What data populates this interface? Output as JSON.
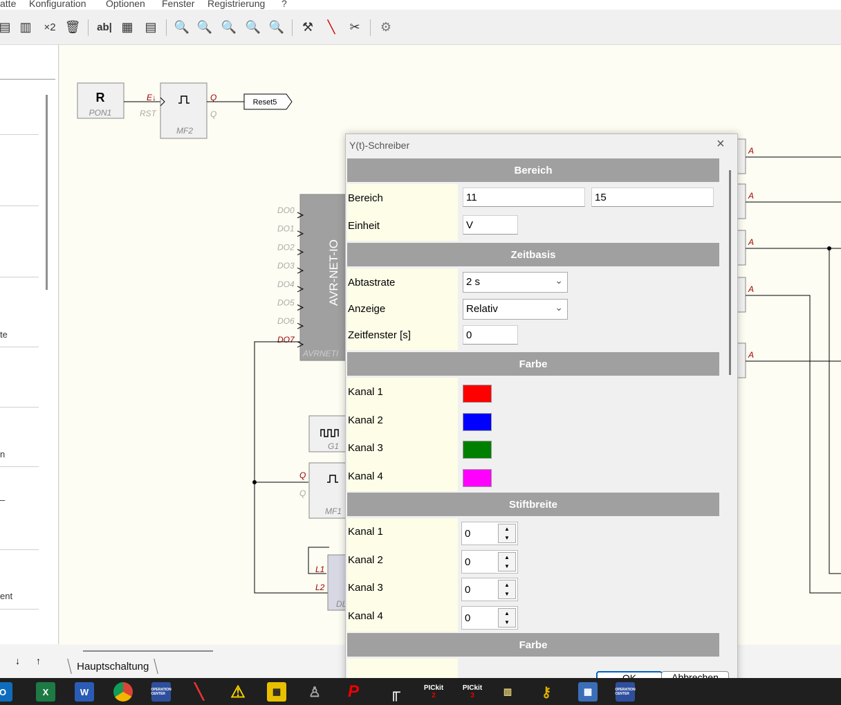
{
  "menu": [
    "atte",
    "Konfiguration",
    "Optionen",
    "Fenster",
    "Registrierung",
    "?"
  ],
  "toolbar": {
    "x2_label": "×2",
    "ab_label": "ab|",
    "icons": [
      "paste-icon",
      "paste-special-icon",
      "duplicate-icon",
      "delete-icon",
      "text-tool-icon",
      "grid-icon",
      "page-icon",
      "zoom-in-icon",
      "zoom-out-icon",
      "zoom-fit-icon",
      "zoom-selection-icon",
      "zoom-disabled-icon",
      "build-icon",
      "probe-icon",
      "tools-icon",
      "settings-gear-icon"
    ]
  },
  "left_panel": {
    "fragments": [
      "te",
      "n",
      "–",
      "ent"
    ],
    "nav_down": "↓",
    "nav_up": "↑"
  },
  "canvas": {
    "tab_label": "Hauptschaltung",
    "blocks": {
      "r_letter": "R",
      "pon1": "PON1",
      "e_pin": "E↓",
      "rst_pin": "RST",
      "q_pin": "Q",
      "qbar_pin": "Q",
      "mf2": "MF2",
      "reset5": "Reset5",
      "avr_title": "AVR-NET-IO",
      "avr_name": "AVRNETI",
      "do_pins": [
        "DO0",
        "DO1",
        "DO2",
        "DO3",
        "DO4",
        "DO5",
        "DO6",
        "DO7"
      ],
      "g1": "G1",
      "mf1": "MF1",
      "mf1_qbar": "Q",
      "mf1_q": "Q",
      "l1": "L1",
      "l2": "L2",
      "dl": "DL",
      "a_label": "A"
    }
  },
  "dialog": {
    "title": "Y(t)-Schreiber",
    "close": "×",
    "sections": {
      "bereich": "Bereich",
      "zeitbasis": "Zeitbasis",
      "farbe": "Farbe",
      "stiftbreite": "Stiftbreite",
      "farbe2": "Farbe"
    },
    "bereich_label": "Bereich",
    "bereich_min": "11",
    "bereich_max": "15",
    "einheit_label": "Einheit",
    "einheit_value": "V",
    "abtastrate_label": "Abtastrate",
    "abtastrate_value": "2 s",
    "anzeige_label": "Anzeige",
    "anzeige_value": "Relativ",
    "zeitfenster_label": "Zeitfenster [s]",
    "zeitfenster_value": "0",
    "farbe_kanaele": [
      {
        "label": "Kanal 1",
        "color": "#ff0000"
      },
      {
        "label": "Kanal 2",
        "color": "#0000ff"
      },
      {
        "label": "Kanal 3",
        "color": "#008000"
      },
      {
        "label": "Kanal 4",
        "color": "#ff00ff"
      }
    ],
    "stift_kanaele": [
      {
        "label": "Kanal 1",
        "value": "0"
      },
      {
        "label": "Kanal 2",
        "value": "0"
      },
      {
        "label": "Kanal 3",
        "value": "0"
      },
      {
        "label": "Kanal 4",
        "value": "0"
      }
    ],
    "ok_label": "OK",
    "cancel_label": "Abbrechen"
  },
  "taskbar": {
    "apps": [
      "outlook-icon",
      "excel-icon",
      "word-icon",
      "chrome-icon",
      "operation-center-icon",
      "soldering-tool-icon",
      "warning-app-icon",
      "yellow-grid-app-icon",
      "robot-app-icon",
      "p-app-icon",
      "black-white-app-icon",
      "pickit2-icon",
      "pickit3-icon",
      "programmer-app-icon",
      "key-app-icon",
      "calculator-icon",
      "operation-center-2-icon"
    ],
    "pickit2_label": "PICkit",
    "pickit3_label": "PICkit",
    "opc_label": "OPERATION CENTER"
  }
}
